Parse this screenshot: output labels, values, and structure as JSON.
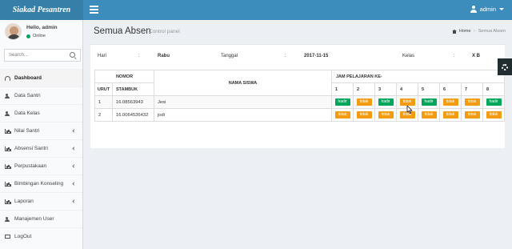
{
  "app": {
    "brand": "Siakad Pesantren"
  },
  "header": {
    "user_label": "admin"
  },
  "sidebar": {
    "user_name": "Hello, admin",
    "status": "Online",
    "search_placeholder": "Search...",
    "items": [
      {
        "label": "Dashboard",
        "icon": "dashboard-icon",
        "has_submenu": false
      },
      {
        "label": "Data Santri",
        "icon": "users-icon",
        "has_submenu": false
      },
      {
        "label": "Data Kelas",
        "icon": "users-icon",
        "has_submenu": false
      },
      {
        "label": "Nilai Santri",
        "icon": "bar-chart-icon",
        "has_submenu": true
      },
      {
        "label": "Absensi Santri",
        "icon": "bar-chart-icon",
        "has_submenu": true
      },
      {
        "label": "Perpustakaan",
        "icon": "bar-chart-icon",
        "has_submenu": true
      },
      {
        "label": "Bimbingan Konseling",
        "icon": "bar-chart-icon",
        "has_submenu": true
      },
      {
        "label": "Laporan",
        "icon": "bar-chart-icon",
        "has_submenu": true
      },
      {
        "label": "Manajemen User",
        "icon": "users-icon",
        "has_submenu": false
      },
      {
        "label": "LogOut",
        "icon": "tv-icon",
        "has_submenu": false
      }
    ]
  },
  "content": {
    "title": "Semua Absen",
    "subtitle": "Control panel",
    "breadcrumb": {
      "home": "Home",
      "sep": ">",
      "current": "Semua Absen"
    }
  },
  "info": {
    "hari_label": "Hari",
    "colon": ":",
    "hari_value": "Rabu",
    "tanggal_label": "Tanggal",
    "tanggal_value": "2017-11-15",
    "kelas_label": "Kelas",
    "kelas_value": "X B"
  },
  "table": {
    "nomor_header": "NOMOR",
    "urut_header": "URUT",
    "stambuk_header": "STAMBUK",
    "nama_header": "NAMA SISWA",
    "jam_header": "JAM PELAJARAN KE-",
    "jam_numbers": [
      "1",
      "2",
      "3",
      "4",
      "5",
      "6",
      "7",
      "8"
    ],
    "rows": [
      {
        "urut": "1",
        "stambuk": "16.08563943",
        "nama": "Jesi",
        "status": [
          "hadir",
          "tidak",
          "hadir",
          "tidak",
          "hadir",
          "tidak",
          "tidak",
          "hadir"
        ]
      },
      {
        "urut": "2",
        "stambuk": "16.0064536432",
        "nama": "jodi",
        "status": [
          "tidak",
          "tidak",
          "tidak",
          "tidak",
          "tidak",
          "tidak",
          "tidak",
          "tidak"
        ]
      }
    ]
  },
  "colors": {
    "hadir": "#00a65a",
    "tidak": "#f39c12",
    "header": "#3c8dbc",
    "logo": "#367fa9"
  }
}
